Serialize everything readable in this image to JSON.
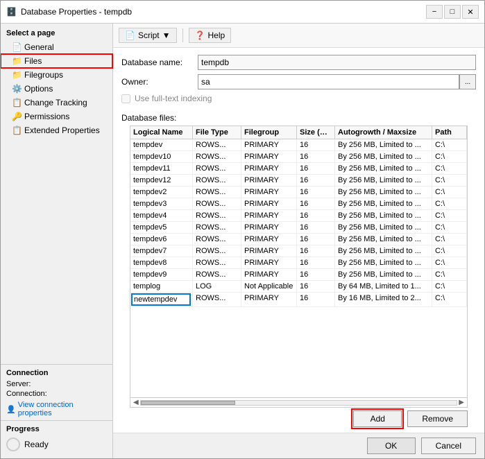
{
  "window": {
    "title": "Database Properties - tempdb",
    "icon": "🗄️"
  },
  "titleControls": {
    "minimize": "−",
    "maximize": "□",
    "close": "✕"
  },
  "toolbar": {
    "script_label": "Script",
    "help_label": "Help"
  },
  "sidebar": {
    "select_page_label": "Select a page",
    "items": [
      {
        "id": "general",
        "label": "General",
        "icon": "📄"
      },
      {
        "id": "files",
        "label": "Files",
        "icon": "📁"
      },
      {
        "id": "filegroups",
        "label": "Filegroups",
        "icon": "📁"
      },
      {
        "id": "options",
        "label": "Options",
        "icon": "⚙️"
      },
      {
        "id": "change-tracking",
        "label": "Change Tracking",
        "icon": "📋"
      },
      {
        "id": "permissions",
        "label": "Permissions",
        "icon": "🔑"
      },
      {
        "id": "extended-props",
        "label": "Extended Properties",
        "icon": "📋"
      }
    ]
  },
  "connection": {
    "header": "Connection",
    "server_label": "Server:",
    "server_value": "",
    "connection_label": "Connection:",
    "connection_value": "",
    "view_link": "View connection properties"
  },
  "progress": {
    "header": "Progress",
    "status": "Ready"
  },
  "form": {
    "db_name_label": "Database name:",
    "db_name_value": "tempdb",
    "owner_label": "Owner:",
    "owner_value": "sa",
    "owner_btn": "...",
    "checkbox_label": "Use full-text indexing",
    "db_files_label": "Database files:"
  },
  "table": {
    "headers": [
      {
        "id": "logical",
        "label": "Logical Name"
      },
      {
        "id": "filetype",
        "label": "File Type"
      },
      {
        "id": "filegroup",
        "label": "Filegroup"
      },
      {
        "id": "size",
        "label": "Size (MB)"
      },
      {
        "id": "autogrowth",
        "label": "Autogrowth / Maxsize"
      },
      {
        "id": "path",
        "label": "Path"
      }
    ],
    "rows": [
      {
        "logical": "tempdev",
        "filetype": "ROWS...",
        "filegroup": "PRIMARY",
        "size": "16",
        "autogrowth": "By 256 MB, Limited to ...",
        "path": "C:\\"
      },
      {
        "logical": "tempdev10",
        "filetype": "ROWS...",
        "filegroup": "PRIMARY",
        "size": "16",
        "autogrowth": "By 256 MB, Limited to ...",
        "path": "C:\\"
      },
      {
        "logical": "tempdev11",
        "filetype": "ROWS...",
        "filegroup": "PRIMARY",
        "size": "16",
        "autogrowth": "By 256 MB, Limited to ...",
        "path": "C:\\"
      },
      {
        "logical": "tempdev12",
        "filetype": "ROWS...",
        "filegroup": "PRIMARY",
        "size": "16",
        "autogrowth": "By 256 MB, Limited to ...",
        "path": "C:\\"
      },
      {
        "logical": "tempdev2",
        "filetype": "ROWS...",
        "filegroup": "PRIMARY",
        "size": "16",
        "autogrowth": "By 256 MB, Limited to ...",
        "path": "C:\\"
      },
      {
        "logical": "tempdev3",
        "filetype": "ROWS...",
        "filegroup": "PRIMARY",
        "size": "16",
        "autogrowth": "By 256 MB, Limited to ...",
        "path": "C:\\"
      },
      {
        "logical": "tempdev4",
        "filetype": "ROWS...",
        "filegroup": "PRIMARY",
        "size": "16",
        "autogrowth": "By 256 MB, Limited to ...",
        "path": "C:\\"
      },
      {
        "logical": "tempdev5",
        "filetype": "ROWS...",
        "filegroup": "PRIMARY",
        "size": "16",
        "autogrowth": "By 256 MB, Limited to ...",
        "path": "C:\\"
      },
      {
        "logical": "tempdev6",
        "filetype": "ROWS...",
        "filegroup": "PRIMARY",
        "size": "16",
        "autogrowth": "By 256 MB, Limited to ...",
        "path": "C:\\"
      },
      {
        "logical": "tempdev7",
        "filetype": "ROWS...",
        "filegroup": "PRIMARY",
        "size": "16",
        "autogrowth": "By 256 MB, Limited to ...",
        "path": "C:\\"
      },
      {
        "logical": "tempdev8",
        "filetype": "ROWS...",
        "filegroup": "PRIMARY",
        "size": "16",
        "autogrowth": "By 256 MB, Limited to ...",
        "path": "C:\\"
      },
      {
        "logical": "tempdev9",
        "filetype": "ROWS...",
        "filegroup": "PRIMARY",
        "size": "16",
        "autogrowth": "By 256 MB, Limited to ...",
        "path": "C:\\"
      },
      {
        "logical": "templog",
        "filetype": "LOG",
        "filegroup": "Not Applicable",
        "size": "16",
        "autogrowth": "By 64 MB, Limited to 1...",
        "path": "C:\\"
      },
      {
        "logical": "newtempdev",
        "filetype": "ROWS...",
        "filegroup": "PRIMARY",
        "size": "16",
        "autogrowth": "By 16 MB, Limited to 2...",
        "path": "C:\\",
        "editing": true
      }
    ]
  },
  "buttons": {
    "add": "Add",
    "remove": "Remove",
    "ok": "OK",
    "cancel": "Cancel"
  }
}
